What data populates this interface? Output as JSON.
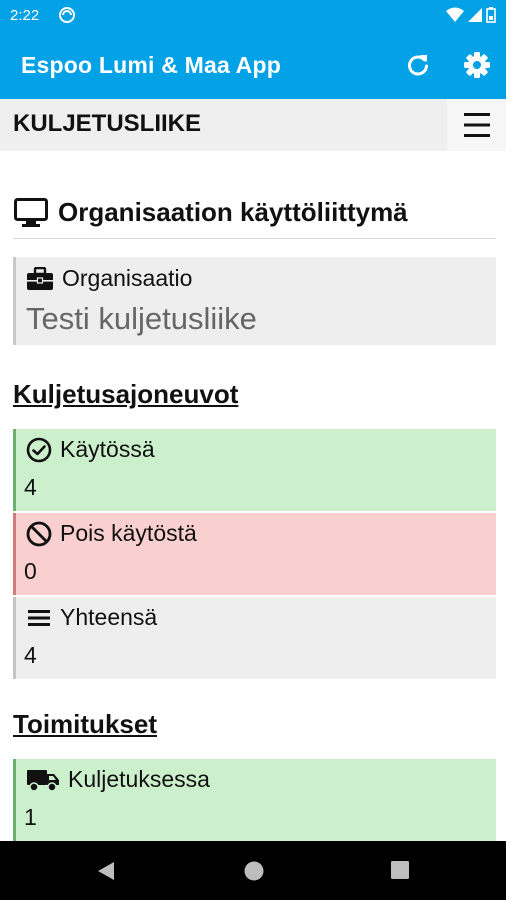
{
  "status_bar": {
    "time": "2:22"
  },
  "app_bar": {
    "title": "Espoo Lumi & Maa App"
  },
  "section_bar": {
    "label": "KULJETUSLIIKE"
  },
  "main": {
    "heading": "Organisaation käyttöliittymä",
    "organization": {
      "label": "Organisaatio",
      "value": "Testi kuljetusliike"
    },
    "vehicles": {
      "heading": "Kuljetusajoneuvot",
      "items": [
        {
          "label": "Käytössä",
          "value": "4",
          "status": "green",
          "icon": "check-circle-icon"
        },
        {
          "label": "Pois käytöstä",
          "value": "0",
          "status": "red",
          "icon": "ban-icon"
        },
        {
          "label": "Yhteensä",
          "value": "4",
          "status": "grey",
          "icon": "list-icon"
        }
      ]
    },
    "deliveries": {
      "heading": "Toimitukset",
      "items": [
        {
          "label": "Kuljetuksessa",
          "value": "1",
          "status": "green",
          "icon": "truck-icon"
        }
      ]
    }
  },
  "colors": {
    "primary": "#03a1e6",
    "green_bg": "#cdf0cc",
    "red_bg": "#f9cfcf",
    "grey_bg": "#eeeeee"
  }
}
